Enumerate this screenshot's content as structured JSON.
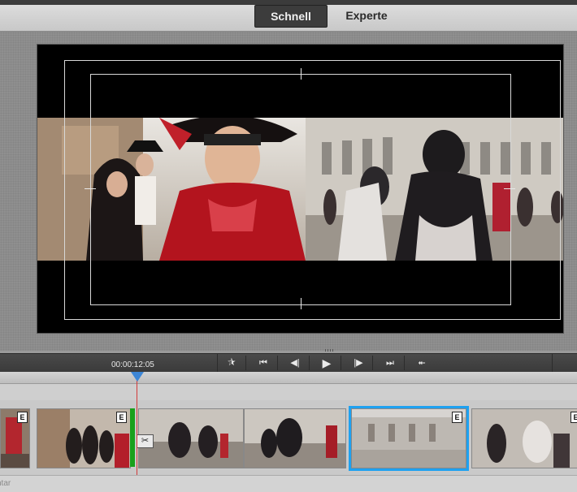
{
  "mode_bar": {
    "quick_label": "Schnell",
    "expert_label": "Experte"
  },
  "transport": {
    "timecode": "00:00:12:05",
    "buttons": [
      {
        "icon": "go-to-start-icon",
        "glyph": "⯫"
      },
      {
        "icon": "previous-edit-icon",
        "glyph": "⏮"
      },
      {
        "icon": "step-back-icon",
        "glyph": "◀|"
      },
      {
        "icon": "play-icon",
        "glyph": "▶"
      },
      {
        "icon": "step-forward-icon",
        "glyph": "|▶"
      },
      {
        "icon": "next-edit-icon",
        "glyph": "⏭"
      },
      {
        "icon": "go-to-end-icon",
        "glyph": "⯬"
      }
    ]
  },
  "timeline": {
    "clips": [
      {
        "badge": "E"
      },
      {
        "badge": "E"
      },
      {
        "badge": ""
      },
      {
        "badge": ""
      },
      {
        "badge": "E",
        "selected": true
      },
      {
        "badge": "E"
      }
    ]
  },
  "bottom_bar": {
    "narration_label": "ntar"
  },
  "colors": {
    "selection": "#1ea1f0",
    "playhead": "#d23b3b",
    "playhead_handle": "#3d86d6",
    "marker": "#19a01c"
  }
}
